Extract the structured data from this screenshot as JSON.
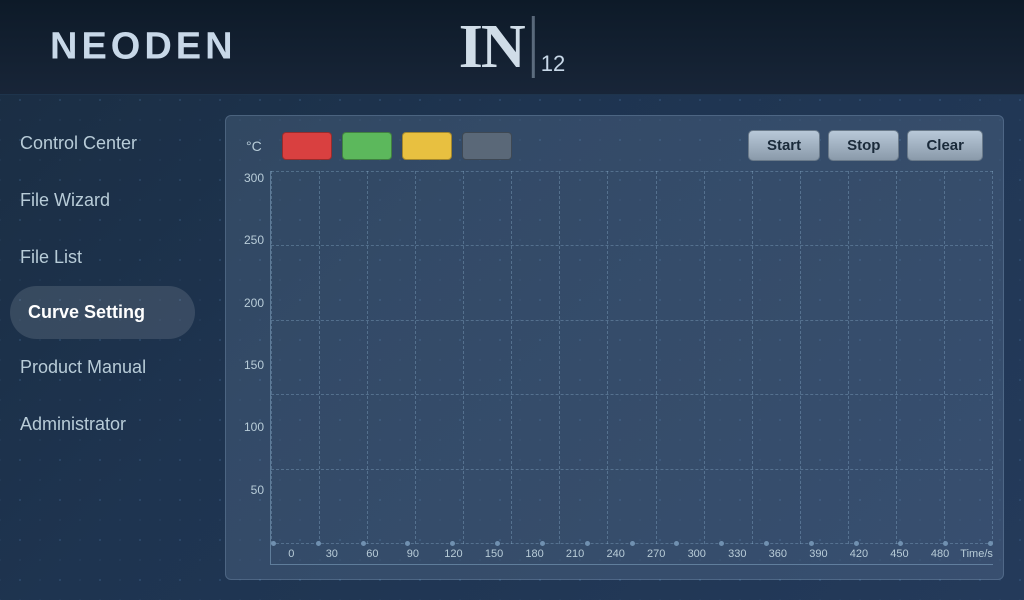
{
  "app": {
    "title": "NEODEN",
    "logo_in": "IN",
    "logo_num": "12"
  },
  "sidebar": {
    "items": [
      {
        "id": "control-center",
        "label": "Control Center",
        "active": false
      },
      {
        "id": "file-wizard",
        "label": "File Wizard",
        "active": false
      },
      {
        "id": "file-list",
        "label": "File List",
        "active": false
      },
      {
        "id": "curve-setting",
        "label": "Curve Setting",
        "active": true
      },
      {
        "id": "product-manual",
        "label": "Product Manual",
        "active": false
      },
      {
        "id": "administrator",
        "label": "Administrator",
        "active": false
      }
    ]
  },
  "toolbar": {
    "temp_unit": "°C",
    "swatches": [
      {
        "color": "#d94040",
        "label": "red-swatch"
      },
      {
        "color": "#5cb85c",
        "label": "green-swatch"
      },
      {
        "color": "#e8c040",
        "label": "yellow-swatch"
      },
      {
        "color": "#5a6878",
        "label": "gray-swatch"
      }
    ],
    "start_label": "Start",
    "stop_label": "Stop",
    "clear_label": "Clear"
  },
  "chart": {
    "y_labels": [
      "300",
      "250",
      "200",
      "150",
      "100",
      "50",
      ""
    ],
    "x_labels": [
      "0",
      "30",
      "60",
      "90",
      "120",
      "150",
      "180",
      "210",
      "240",
      "270",
      "300",
      "330",
      "360",
      "390",
      "420",
      "450",
      "480"
    ],
    "x_time_unit": "Time/s"
  }
}
